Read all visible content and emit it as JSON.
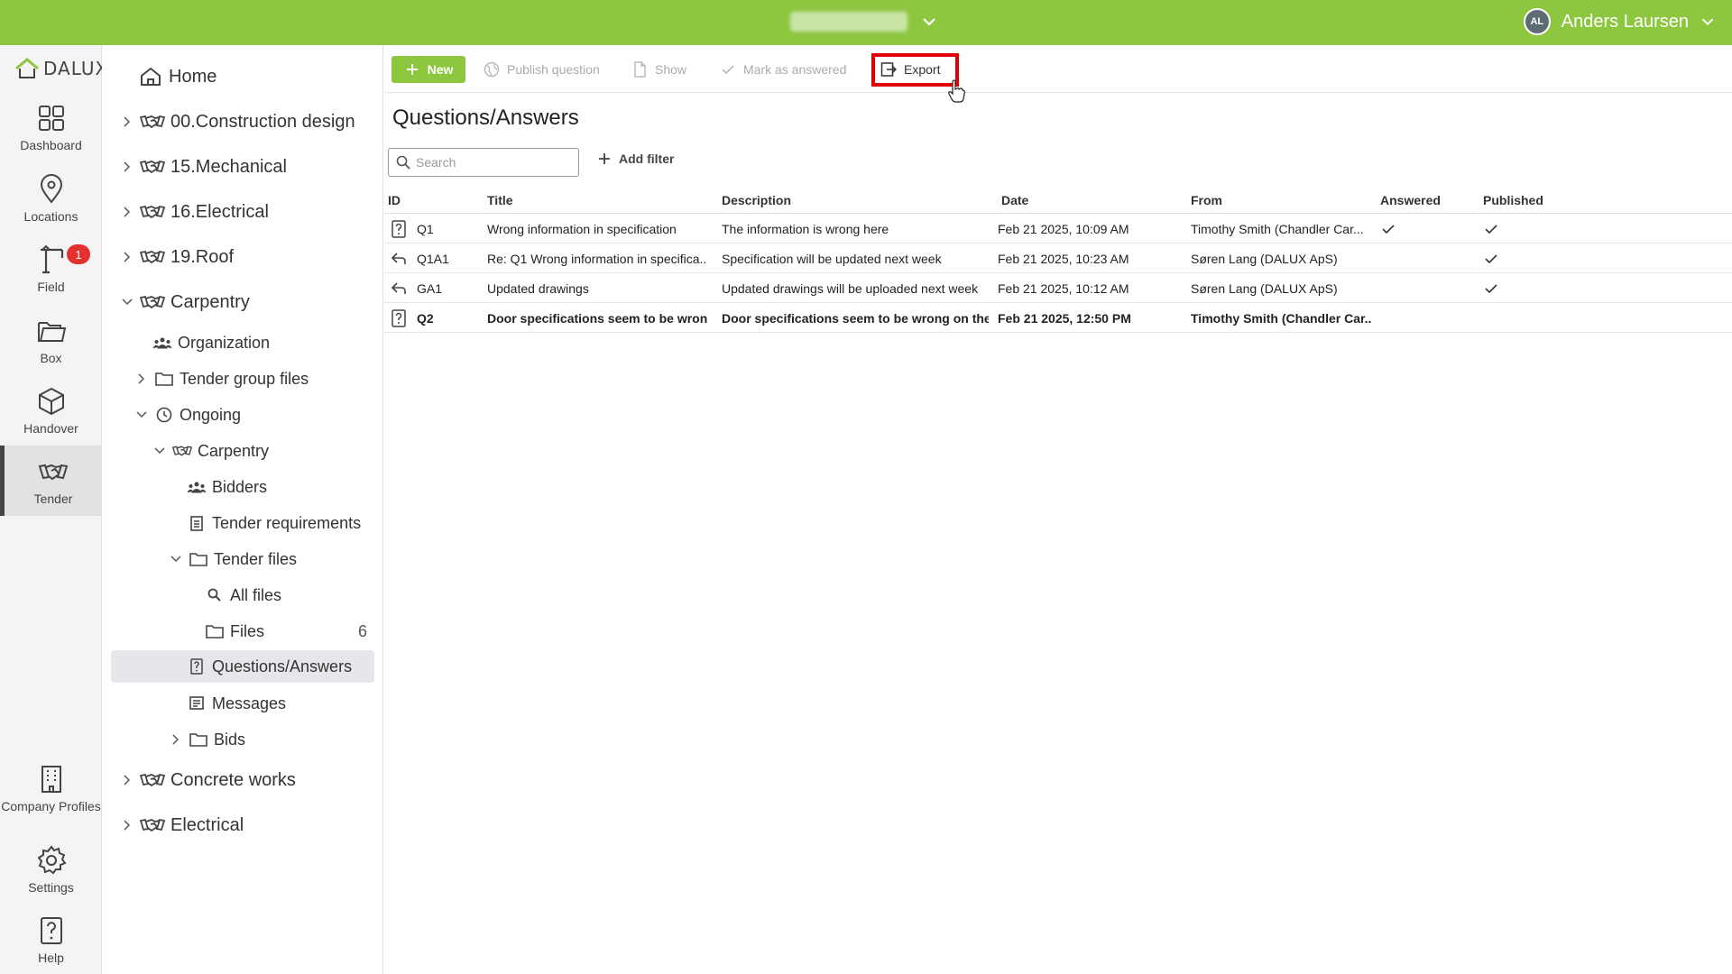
{
  "topbar": {
    "user_initials": "AL",
    "user_name": "Anders Laursen"
  },
  "rail": {
    "logo_text": "DALUX",
    "items": [
      {
        "label": "Dashboard"
      },
      {
        "label": "Locations"
      },
      {
        "label": "Field",
        "badge": "1"
      },
      {
        "label": "Box"
      },
      {
        "label": "Handover"
      },
      {
        "label": "Tender"
      },
      {
        "label": "Company Profiles"
      },
      {
        "label": "Settings"
      },
      {
        "label": "Help"
      }
    ]
  },
  "tree": {
    "home": "Home",
    "items": [
      {
        "label": "00.Construction design"
      },
      {
        "label": "15.Mechanical"
      },
      {
        "label": "16.Electrical"
      },
      {
        "label": "19.Roof"
      },
      {
        "label": "Carpentry"
      },
      {
        "label": "Organization"
      },
      {
        "label": "Tender group files"
      },
      {
        "label": "Ongoing"
      },
      {
        "label": "Carpentry"
      },
      {
        "label": "Bidders"
      },
      {
        "label": "Tender requirements"
      },
      {
        "label": "Tender files"
      },
      {
        "label": "All files"
      },
      {
        "label": "Files",
        "count": "6"
      },
      {
        "label": "Questions/Answers"
      },
      {
        "label": "Messages"
      },
      {
        "label": "Bids"
      },
      {
        "label": "Concrete works"
      },
      {
        "label": "Electrical"
      }
    ]
  },
  "toolbar": {
    "new_label": "New",
    "publish_label": "Publish question",
    "show_label": "Show",
    "mark_label": "Mark as answered",
    "export_label": "Export"
  },
  "main": {
    "title": "Questions/Answers",
    "search_placeholder": "Search",
    "add_filter_label": "Add filter"
  },
  "table": {
    "headers": {
      "id": "ID",
      "title": "Title",
      "description": "Description",
      "date": "Date",
      "from": "From",
      "answered": "Answered",
      "published": "Published"
    },
    "rows": [
      {
        "type": "question",
        "id": "Q1",
        "title": "Wrong information in specification",
        "description": "The information is wrong here",
        "date": "Feb 21 2025, 10:09 AM",
        "from": "Timothy Smith (Chandler Car...",
        "answered": true,
        "published": true,
        "bold": false
      },
      {
        "type": "answer",
        "id": "Q1A1",
        "title": "Re: Q1 Wrong information in specifica...",
        "description": "Specification will be updated next week",
        "date": "Feb 21 2025, 10:23 AM",
        "from": "Søren Lang (DALUX ApS)",
        "answered": false,
        "published": true,
        "bold": false
      },
      {
        "type": "answer",
        "id": "GA1",
        "title": "Updated drawings",
        "description": "Updated drawings will be uploaded next week",
        "date": "Feb 21 2025, 10:12 AM",
        "from": "Søren Lang (DALUX ApS)",
        "answered": false,
        "published": true,
        "bold": false
      },
      {
        "type": "question",
        "id": "Q2",
        "title": "Door specifications seem to be wrong",
        "description": "Door specifications seem to be wrong on the ...",
        "date": "Feb 21 2025, 12:50 PM",
        "from": "Timothy Smith (Chandler Car...",
        "answered": false,
        "published": false,
        "bold": true
      }
    ]
  }
}
